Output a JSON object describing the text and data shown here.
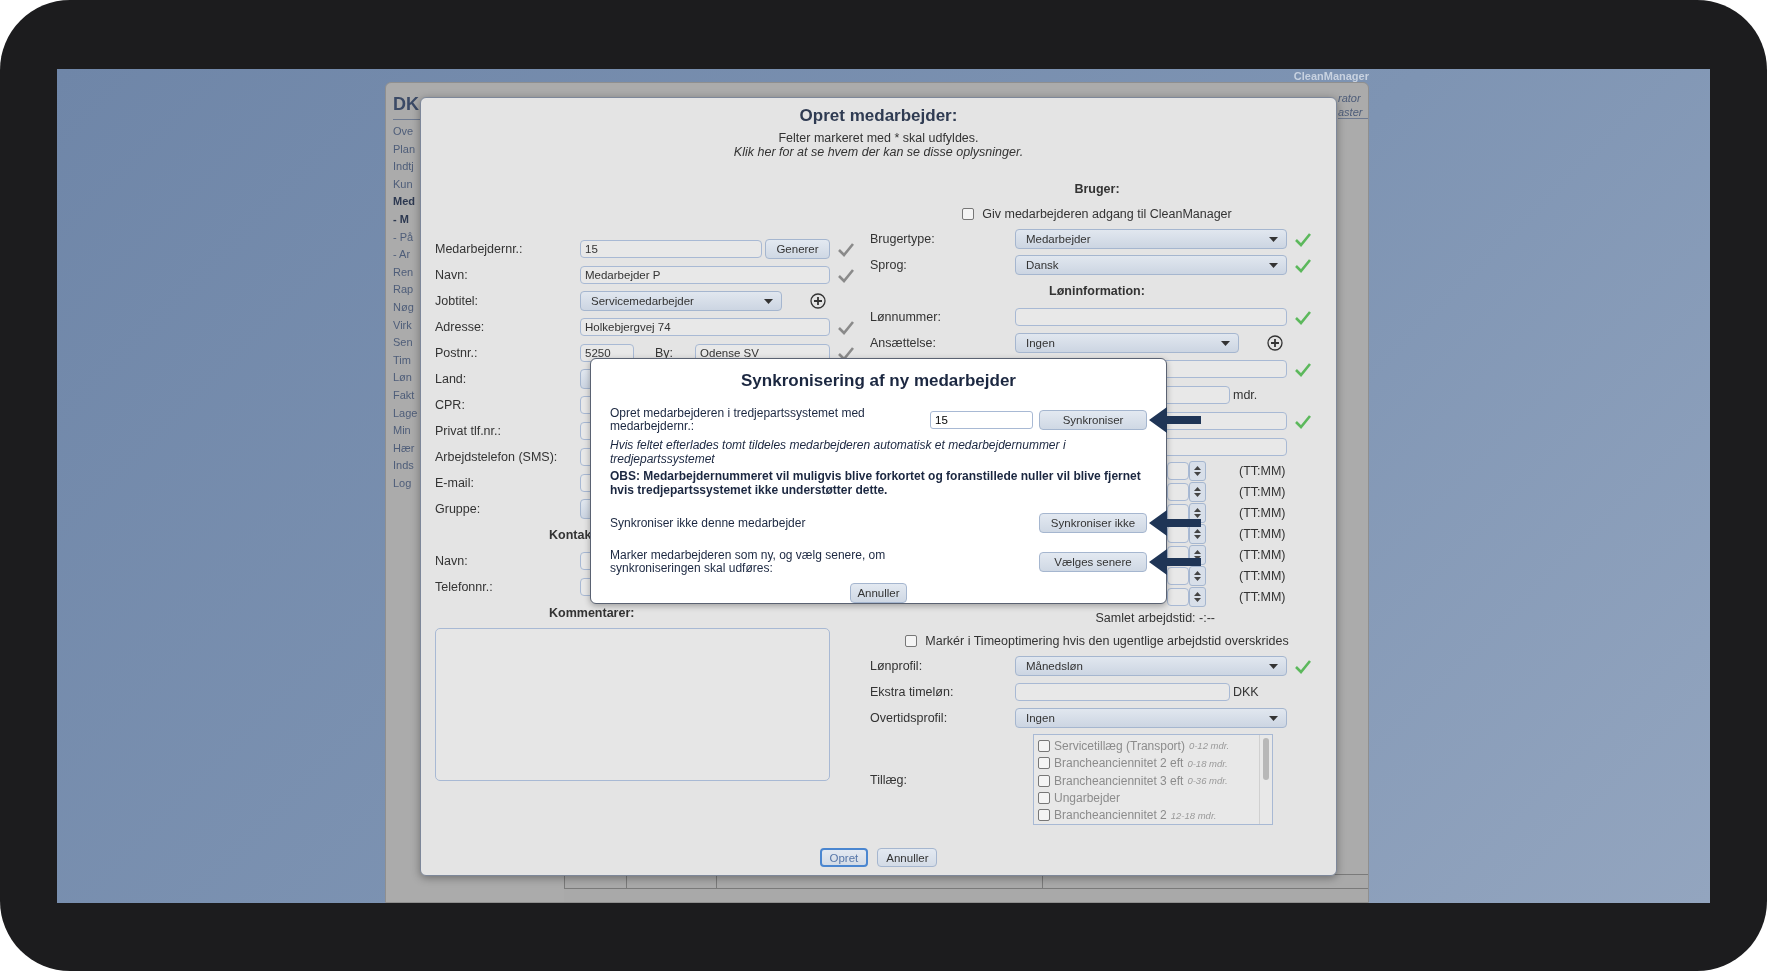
{
  "app": {
    "brand": "CleanManager",
    "corner_texts": [
      "rator",
      "aster"
    ]
  },
  "nav": {
    "heading": "DK",
    "items": [
      {
        "label": "Ove",
        "selected": false
      },
      {
        "label": "Plan",
        "selected": false
      },
      {
        "label": "Indtj",
        "selected": false
      },
      {
        "label": "Kun",
        "selected": false
      },
      {
        "label": "Med",
        "selected": true
      },
      {
        "label": "- M",
        "selected": true
      },
      {
        "label": "- På",
        "selected": false
      },
      {
        "label": "- Ar",
        "selected": false
      },
      {
        "label": "Ren",
        "selected": false
      },
      {
        "label": "Rap",
        "selected": false
      },
      {
        "label": "Nøg",
        "selected": false
      },
      {
        "label": "Virk",
        "selected": false
      },
      {
        "label": "Sen",
        "selected": false
      },
      {
        "label": "Tim",
        "selected": false
      },
      {
        "label": "Løn",
        "selected": false
      },
      {
        "label": "Fakt",
        "selected": false
      },
      {
        "label": "Lage",
        "selected": false
      },
      {
        "label": "Min",
        "selected": false
      },
      {
        "label": "Hær",
        "selected": false
      },
      {
        "label": "Inds",
        "selected": false
      },
      {
        "label": "Log",
        "selected": false
      }
    ]
  },
  "dialog": {
    "title": "Opret medarbejder:",
    "subtitle": "Felter markeret med * skal udfyldes.",
    "info_link": "Klik her for at se hvem der kan se disse oplysninger.",
    "left": [
      {
        "kind": "input_button",
        "label": "Medarbejdernr.:",
        "value": "15",
        "button": "Generer",
        "check": true
      },
      {
        "kind": "input",
        "label": "Navn:",
        "value": "Medarbejder P",
        "check": true
      },
      {
        "kind": "select",
        "label": "Jobtitel:",
        "value": "Servicemedarbejder",
        "add": true
      },
      {
        "kind": "input",
        "label": "Adresse:",
        "value": "Holkebjergvej 74",
        "check": true
      },
      {
        "kind": "postal",
        "label": "Postnr.:",
        "value": "5250",
        "city_label": "By:",
        "city": "Odense SV",
        "check": true
      },
      {
        "kind": "select",
        "label": "Land:"
      },
      {
        "kind": "input",
        "label": "CPR:"
      },
      {
        "kind": "input",
        "label": "Privat tlf.nr.:"
      },
      {
        "kind": "input",
        "label": "Arbejdstelefon (SMS):"
      },
      {
        "kind": "input",
        "label": "E-mail:"
      },
      {
        "kind": "select",
        "label": "Gruppe:"
      },
      {
        "kind": "heading",
        "text": "Kontak"
      },
      {
        "kind": "input",
        "label": "Navn:"
      },
      {
        "kind": "input",
        "label": "Telefonnr.:"
      },
      {
        "kind": "heading",
        "text": "Kommentarer:"
      },
      {
        "kind": "textarea"
      }
    ],
    "right": [
      {
        "kind": "heading",
        "text": "Bruger:"
      },
      {
        "kind": "checkbox",
        "text": "Giv medarbejderen adgang til CleanManager",
        "checked": false
      },
      {
        "kind": "select",
        "label": "Brugertype:",
        "value": "Medarbejder",
        "check": true
      },
      {
        "kind": "select",
        "label": "Sprog:",
        "value": "Dansk",
        "check": true
      },
      {
        "kind": "heading",
        "text": "Løninformation:"
      },
      {
        "kind": "input",
        "label": "Lønnummer:",
        "check": true
      },
      {
        "kind": "select",
        "label": "Ansættelse:",
        "value": "Ingen",
        "add": true
      },
      {
        "kind": "split",
        "check": true
      },
      {
        "kind": "input",
        "unit": "mdr."
      },
      {
        "kind": "input",
        "check": true
      },
      {
        "kind": "input"
      },
      {
        "kind": "time",
        "unit": "(TT:MM)"
      },
      {
        "kind": "time",
        "unit": "(TT:MM)"
      },
      {
        "kind": "time",
        "unit": "(TT:MM)"
      },
      {
        "kind": "time",
        "unit": "(TT:MM)"
      },
      {
        "kind": "time",
        "unit": "(TT:MM)"
      },
      {
        "kind": "time",
        "unit": "(TT:MM)"
      },
      {
        "kind": "time",
        "unit": "(TT:MM)"
      },
      {
        "kind": "total",
        "text": "Samlet arbejdstid: -:--"
      },
      {
        "kind": "checkbox",
        "text": "Markér i Timeoptimering hvis den ugentlige arbejdstid overskrides",
        "checked": false
      },
      {
        "kind": "select",
        "label": "Lønprofil:",
        "value": "Månedsløn",
        "check": true
      },
      {
        "kind": "input",
        "label": "Ekstra timeløn:",
        "unit": "DKK"
      },
      {
        "kind": "select",
        "label": "Overtidsprofil:",
        "value": "Ingen"
      },
      {
        "kind": "list",
        "label": "Tillæg:",
        "items": [
          {
            "label": "Servicetillæg (Transport)",
            "note": "0-12 mdr.",
            "checked": false
          },
          {
            "label": "Brancheanciennitet 2 eft",
            "note": "0-18 mdr.",
            "checked": false
          },
          {
            "label": "Brancheanciennitet 3 eft",
            "note": "0-36 mdr.",
            "checked": false
          },
          {
            "label": "Ungarbejder",
            "checked": false
          },
          {
            "label": "Brancheanciennitet 2",
            "note": "12-18 mdr.",
            "checked": false
          }
        ]
      }
    ],
    "buttons": [
      {
        "label": "Opret",
        "primary": true
      },
      {
        "label": "Annuller",
        "primary": false
      }
    ]
  },
  "sync_modal": {
    "title": "Synkronisering af ny medarbejder",
    "sections": [
      {
        "kind": "option",
        "text": "Opret medarbejderen i tredjepartssystemet med medarbejdernr.:",
        "value": "15",
        "button": "Synkroniser",
        "arrow": true
      },
      {
        "kind": "note",
        "text": "Hvis feltet efterlades tomt tildeles medarbejderen automatisk et medarbejdernummer i tredjepartssystemet"
      },
      {
        "kind": "warning",
        "text": "OBS: Medarbejdernummeret vil muligvis blive forkortet og foranstillede nuller vil blive fjernet hvis tredjepartssystemet ikke understøtter dette."
      },
      {
        "kind": "option",
        "text": "Synkroniser ikke denne medarbejder",
        "button": "Synkroniser ikke",
        "arrow": true
      },
      {
        "kind": "option",
        "text": "Marker medarbejderen som ny, og vælg senere, om synkroniseringen skal udføres:",
        "button": "Vælges senere",
        "arrow": true
      }
    ],
    "cancel": "Annuller"
  }
}
